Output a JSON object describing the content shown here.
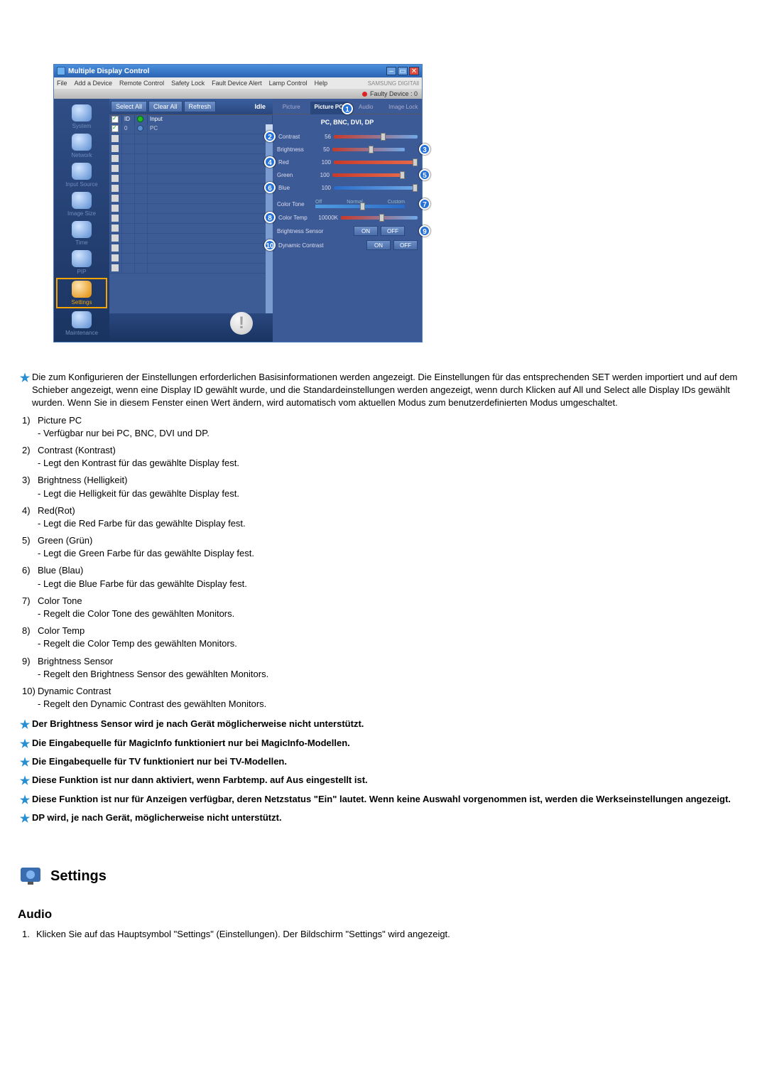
{
  "window": {
    "title": "Multiple Display Control",
    "menu": [
      "File",
      "Add a Device",
      "Remote Control",
      "Safety Lock",
      "Fault Device Alert",
      "Lamp Control",
      "Help"
    ],
    "brand": "SAMSUNG DIGITAll",
    "faulty_label": "Faulty Device : 0",
    "toolbar": {
      "select_all": "Select All",
      "clear_all": "Clear All",
      "refresh": "Refresh",
      "idle": "Idle"
    },
    "grid_head": {
      "id": "ID",
      "input": "Input"
    },
    "grid_first": {
      "id": "0",
      "input": "PC"
    },
    "sidebar": [
      {
        "label": "System"
      },
      {
        "label": "Network"
      },
      {
        "label": "Input Source"
      },
      {
        "label": "Image Size"
      },
      {
        "label": "Time"
      },
      {
        "label": "PIP"
      },
      {
        "label": "Settings",
        "active": true
      },
      {
        "label": "Maintenance"
      }
    ],
    "tabs": [
      "Picture",
      "Picture PC",
      "Audio",
      "Image Lock"
    ],
    "active_tab": 1,
    "sub_head": "PC, BNC, DVI, DP",
    "sliders": {
      "contrast": {
        "label": "Contrast",
        "value": "56",
        "pos": 56
      },
      "brightness": {
        "label": "Brightness",
        "value": "50",
        "pos": 50
      },
      "red": {
        "label": "Red",
        "value": "100",
        "pos": 100
      },
      "green": {
        "label": "Green",
        "value": "100",
        "pos": 100
      },
      "blue": {
        "label": "Blue",
        "value": "100",
        "pos": 100
      }
    },
    "color_tone": {
      "label": "Color Tone",
      "options": [
        "Off",
        "Normal",
        "Custom"
      ],
      "pos": 50
    },
    "color_temp": {
      "label": "Color Temp",
      "value": "10000K",
      "pos": 50
    },
    "brightness_sensor": {
      "label": "Brightness Sensor",
      "on": "ON",
      "off": "OFF"
    },
    "dynamic_contrast": {
      "label": "Dynamic Contrast",
      "on": "ON",
      "off": "OFF"
    }
  },
  "intro_star": "Die zum Konfigurieren der Einstellungen erforderlichen Basisinformationen werden angezeigt. Die Einstellungen für das entsprechenden SET werden importiert und auf dem Schieber angezeigt, wenn eine Display ID gewählt wurde, und die Standardeinstellungen werden angezeigt, wenn durch Klicken auf All und Select alle Display IDs gewählt wurden. Wenn Sie in diesem Fenster einen Wert ändern, wird automatisch vom aktuellen Modus zum benutzerdefinierten Modus umgeschaltet.",
  "items": [
    {
      "n": "1)",
      "title": "Picture PC",
      "desc": "- Verfügbar nur bei PC, BNC, DVI und DP."
    },
    {
      "n": "2)",
      "title": "Contrast (Kontrast)",
      "desc": "- Legt den Kontrast für das gewählte Display fest."
    },
    {
      "n": "3)",
      "title": "Brightness (Helligkeit)",
      "desc": "- Legt die Helligkeit für das gewählte Display fest."
    },
    {
      "n": "4)",
      "title": "Red(Rot)",
      "desc": "- Legt die Red Farbe für das gewählte Display fest."
    },
    {
      "n": "5)",
      "title": "Green (Grün)",
      "desc": "- Legt die Green Farbe für das gewählte Display fest."
    },
    {
      "n": "6)",
      "title": "Blue (Blau)",
      "desc": "- Legt die Blue Farbe für das gewählte Display fest."
    },
    {
      "n": "7)",
      "title": "Color Tone",
      "desc": "- Regelt die Color Tone des gewählten Monitors."
    },
    {
      "n": "8)",
      "title": "Color Temp",
      "desc": "- Regelt die Color Temp des gewählten Monitors."
    },
    {
      "n": "9)",
      "title": "Brightness Sensor",
      "desc": "- Regelt den Brightness Sensor des gewählten Monitors."
    },
    {
      "n": "10)",
      "title": "Dynamic Contrast",
      "desc": "- Regelt den Dynamic Contrast des gewählten Monitors."
    }
  ],
  "notes": [
    "Der Brightness Sensor wird je nach Gerät möglicherweise nicht unterstützt.",
    "Die Eingabequelle für MagicInfo funktioniert nur bei MagicInfo-Modellen.",
    "Die Eingabequelle für TV funktioniert nur bei TV-Modellen.",
    "Diese Funktion ist nur dann aktiviert, wenn Farbtemp. auf Aus eingestellt ist.",
    "Diese Funktion ist nur für Anzeigen verfügbar, deren Netzstatus \"Ein\" lautet. Wenn keine Auswahl vorgenommen ist, werden die Werkseinstellungen angezeigt.",
    "DP wird, je nach Gerät, möglicherweise nicht unterstützt."
  ],
  "section": {
    "title": "Settings",
    "sub": "Audio",
    "step1_n": "1.",
    "step1": "Klicken Sie auf das Hauptsymbol \"Settings\" (Einstellungen). Der Bildschirm \"Settings\" wird angezeigt."
  }
}
